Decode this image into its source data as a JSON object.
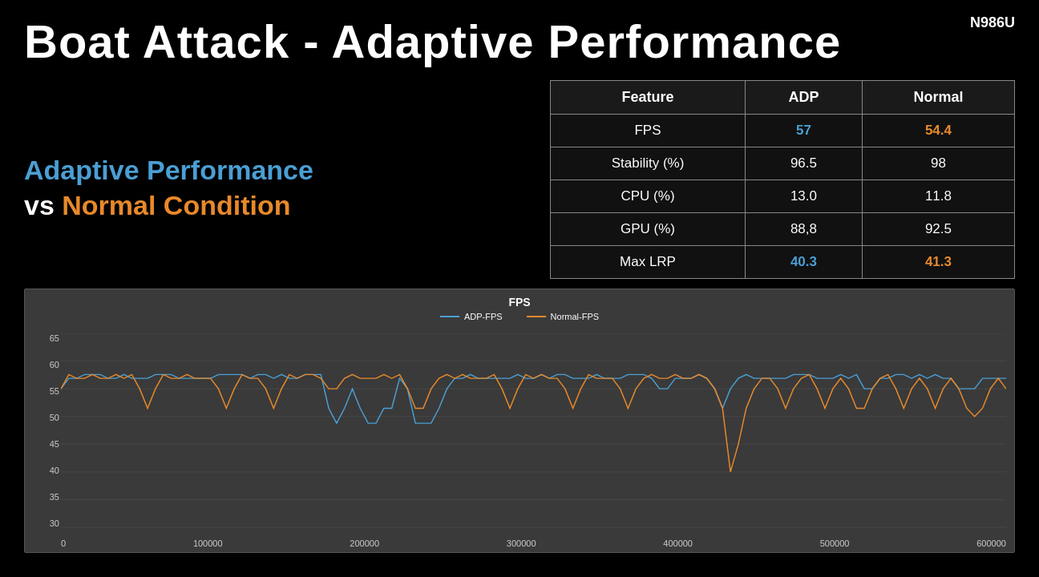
{
  "title": "Boat Attack - Adaptive Performance",
  "device": "N986U",
  "left": {
    "adp_line1": "Adaptive Performance",
    "vs_word": "vs",
    "normal_word": "Normal Condition"
  },
  "table": {
    "headers": [
      "Feature",
      "ADP",
      "Normal"
    ],
    "rows": [
      {
        "feature": "FPS",
        "adp": "57",
        "normal": "54.4",
        "adp_color": "blue",
        "normal_color": "orange"
      },
      {
        "feature": "Stability (%)",
        "adp": "96.5",
        "normal": "98",
        "adp_color": "white",
        "normal_color": "white"
      },
      {
        "feature": "CPU (%)",
        "adp": "13.0",
        "normal": "11.8",
        "adp_color": "white",
        "normal_color": "white"
      },
      {
        "feature": "GPU (%)",
        "adp": "88,8",
        "normal": "92.5",
        "adp_color": "white",
        "normal_color": "white"
      },
      {
        "feature": "Max LRP",
        "adp": "40.3",
        "normal": "41.3",
        "adp_color": "blue",
        "normal_color": "orange"
      }
    ]
  },
  "chart": {
    "title": "FPS",
    "legend": {
      "adp_label": "ADP-FPS",
      "normal_label": "Normal-FPS"
    },
    "y_labels": [
      "65",
      "60",
      "55",
      "50",
      "45",
      "40",
      "35",
      "30"
    ],
    "x_labels": [
      "0",
      "100000",
      "200000",
      "300000",
      "400000",
      "500000",
      "600000"
    ]
  }
}
